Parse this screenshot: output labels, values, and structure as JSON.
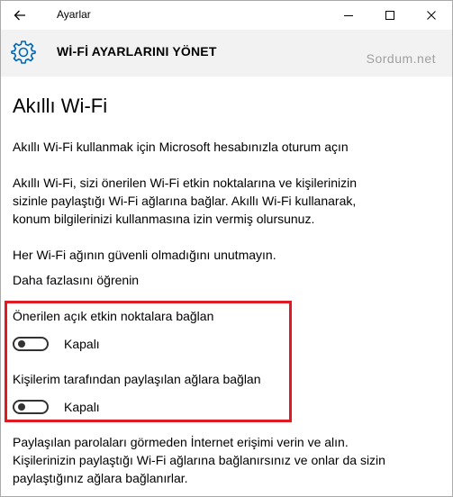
{
  "window": {
    "title": "Ayarlar"
  },
  "header": {
    "title": "Wİ-Fİ AYARLARINI YÖNET",
    "watermark": "Sordum.net"
  },
  "main": {
    "page_title": "Akıllı Wi-Fi",
    "signin_link": "Akıllı Wi-Fi kullanmak için Microsoft hesabınızla oturum açın",
    "description_lines": [
      "Akıllı Wi-Fi, sizi önerilen Wi-Fi etkin noktalarına ve kişilerinizin",
      "sizinle paylaştığı Wi-Fi ağlarına bağlar. Akıllı Wi-Fi kullanarak,",
      "konum bilgilerinizi kullanmasına izin vermiş olursunuz."
    ],
    "warning": "Her Wi-Fi ağının güvenli olmadığını unutmayın.",
    "learn_more_link": "Daha fazlasını öğrenin",
    "settings": [
      {
        "label": "Önerilen açık etkin noktalara bağlan",
        "state": "Kapalı"
      },
      {
        "label": "Kişilerim tarafından paylaşılan ağlara bağlan",
        "state": "Kapalı"
      }
    ],
    "footer_lines": [
      "Paylaşılan parolaları görmeden İnternet erişimi verin ve alın.",
      "Kişilerinizin paylaştığı Wi-Fi ağlarına bağlanırsınız ve onlar da sizin",
      "paylaştığınız ağlara bağlanırlar."
    ]
  },
  "colors": {
    "link": "#0066b4",
    "highlight_border": "#e01a22",
    "header_bg": "#f2f2f2",
    "icon_accent": "#0066b4"
  },
  "icons": {
    "back": "back-arrow-icon",
    "settings": "gear-icon",
    "minimize": "minimize-icon",
    "maximize": "maximize-icon",
    "close": "close-icon"
  }
}
